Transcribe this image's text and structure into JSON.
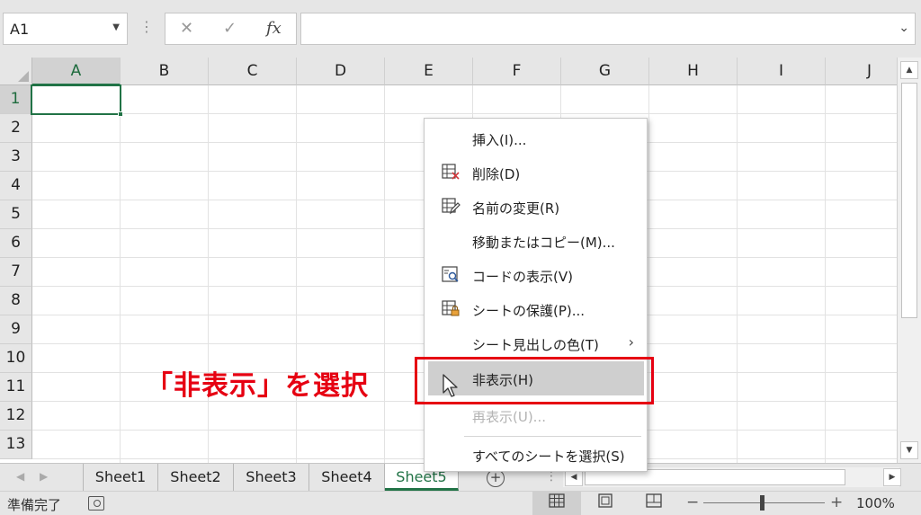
{
  "formula_bar": {
    "name_box": "A1",
    "cancel_glyph": "✕",
    "enter_glyph": "✓",
    "fx_label": "fx",
    "formula_value": ""
  },
  "grid": {
    "columns": [
      "A",
      "B",
      "C",
      "D",
      "E",
      "F",
      "G",
      "H",
      "I",
      "J"
    ],
    "rows": [
      "1",
      "2",
      "3",
      "4",
      "5",
      "6",
      "7",
      "8",
      "9",
      "10",
      "11",
      "12",
      "13"
    ],
    "active_cell": "A1"
  },
  "context_menu": {
    "items": [
      {
        "label": "挿入(I)...",
        "icon": "",
        "disabled": false,
        "submenu": false
      },
      {
        "label": "削除(D)",
        "icon": "delete-sheet-icon",
        "disabled": false,
        "submenu": false
      },
      {
        "label": "名前の変更(R)",
        "icon": "rename-sheet-icon",
        "disabled": false,
        "submenu": false
      },
      {
        "label": "移動またはコピー(M)...",
        "icon": "",
        "disabled": false,
        "submenu": false
      },
      {
        "label": "コードの表示(V)",
        "icon": "view-code-icon",
        "disabled": false,
        "submenu": false
      },
      {
        "label": "シートの保護(P)...",
        "icon": "protect-sheet-icon",
        "disabled": false,
        "submenu": false
      },
      {
        "label": "シート見出しの色(T)",
        "icon": "",
        "disabled": false,
        "submenu": true
      },
      {
        "label": "非表示(H)",
        "icon": "",
        "disabled": false,
        "submenu": false,
        "highlighted": true
      },
      {
        "label": "再表示(U)...",
        "icon": "",
        "disabled": true,
        "submenu": false
      },
      {
        "label": "すべてのシートを選択(S)",
        "icon": "",
        "disabled": false,
        "submenu": false
      }
    ]
  },
  "annotation": {
    "callout_text": "「非表示」を選択",
    "color": "#e60012"
  },
  "sheet_tabs": {
    "tabs": [
      "Sheet1",
      "Sheet2",
      "Sheet3",
      "Sheet4",
      "Sheet5"
    ],
    "active": "Sheet5",
    "add_glyph": "+"
  },
  "status_bar": {
    "status_text": "準備完了",
    "zoom_minus": "−",
    "zoom_plus": "+",
    "zoom_level": "100%"
  },
  "colors": {
    "accent": "#217346",
    "annotation_red": "#e60012",
    "menu_hover": "#cfcfcf"
  }
}
